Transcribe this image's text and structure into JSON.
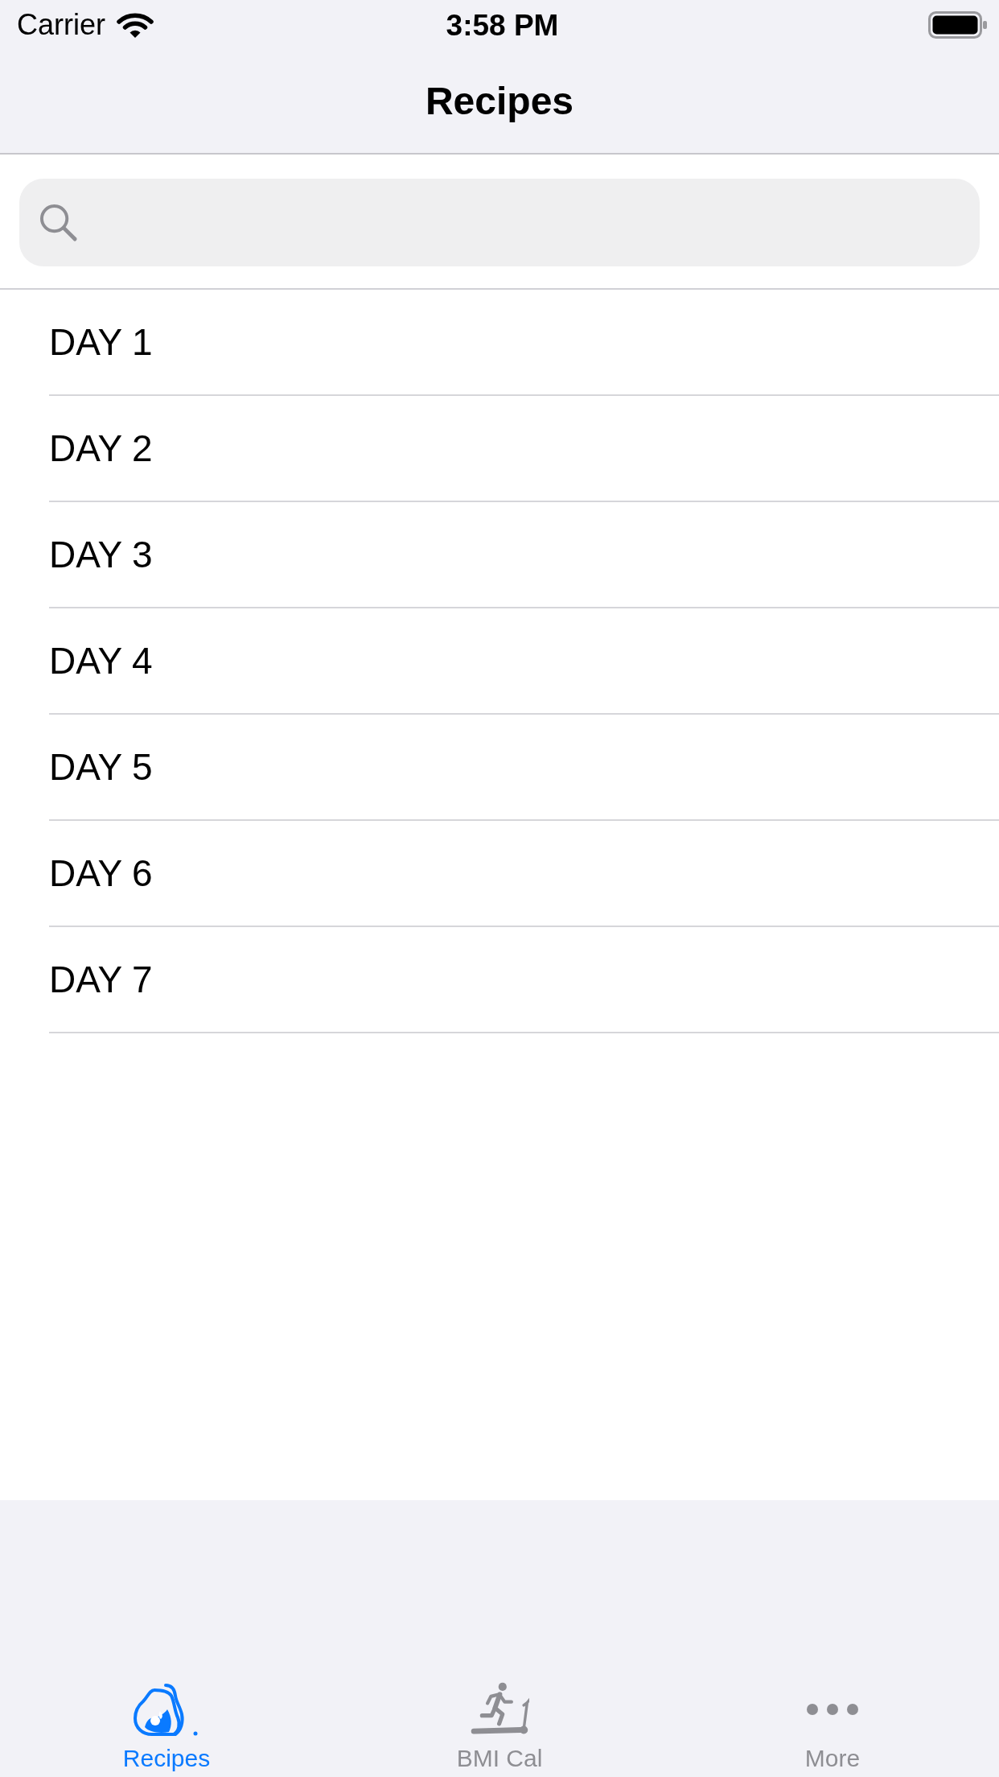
{
  "status_bar": {
    "carrier": "Carrier",
    "time": "3:58 PM"
  },
  "navigation_bar": {
    "title": "Recipes"
  },
  "list": {
    "rows": [
      {
        "label": "DAY 1"
      },
      {
        "label": "DAY 2"
      },
      {
        "label": "DAY 3"
      },
      {
        "label": "DAY 4"
      },
      {
        "label": "DAY 5"
      },
      {
        "label": "DAY 6"
      },
      {
        "label": "DAY 7"
      }
    ]
  },
  "tab_bar": {
    "tabs": [
      {
        "label": "Recipes",
        "selected": true
      },
      {
        "label": "BMI Cal",
        "selected": false
      },
      {
        "label": "More",
        "selected": false
      }
    ]
  }
}
